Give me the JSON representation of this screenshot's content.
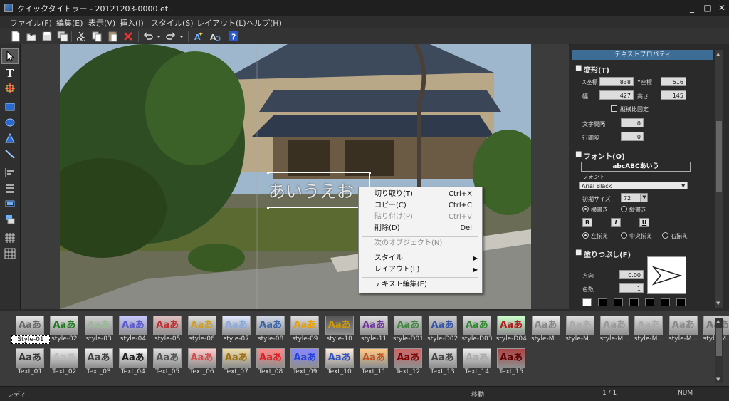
{
  "window": {
    "title": "クイックタイトラー - 20121203-0000.etl",
    "minimize": "_",
    "maximize": "□",
    "close": "✕"
  },
  "menu": [
    "ファイル(F)",
    "編集(E)",
    "表示(V)",
    "挿入(I)",
    "スタイル(S)",
    "レイアウト(L)",
    "ヘルプ(H)"
  ],
  "toolbar": [
    "new-icon",
    "open-icon",
    "save-icon",
    "save-as-icon",
    "cut-icon",
    "copy-icon",
    "paste-icon",
    "delete-icon",
    "undo-icon",
    "redo-icon",
    "text-effect-icon",
    "text-effect2-icon",
    "help-icon"
  ],
  "tools": [
    "select-tool-icon",
    "text-tool-icon",
    "crosshair-tool-icon",
    "rectangle-tool-icon",
    "ellipse-tool-icon",
    "triangle-tool-icon",
    "line-tool-icon",
    "align-tool-icon",
    "distribute-tool-icon",
    "group-tool-icon",
    "layer-tool-icon",
    "grid-tool-icon",
    "grid2-tool-icon"
  ],
  "canvas": {
    "text_object": "あいうえお"
  },
  "context_menu": {
    "items": [
      {
        "label": "切り取り(T)",
        "shortcut": "Ctrl+X",
        "enabled": true
      },
      {
        "label": "コピー(C)",
        "shortcut": "Ctrl+C",
        "enabled": true
      },
      {
        "label": "貼り付け(P)",
        "shortcut": "Ctrl+V",
        "enabled": false
      },
      {
        "label": "削除(D)",
        "shortcut": "Del",
        "enabled": true
      },
      {
        "label": "次のオブジェクト(N)",
        "shortcut": "",
        "enabled": false
      },
      {
        "label": "スタイル",
        "shortcut": "",
        "enabled": true,
        "submenu": true
      },
      {
        "label": "レイアウト(L)",
        "shortcut": "",
        "enabled": true,
        "submenu": true
      },
      {
        "label": "テキスト編集(E)",
        "shortcut": "",
        "enabled": true
      }
    ]
  },
  "props": {
    "title": "テキストプロパティ",
    "transform": {
      "header": "変形(T)",
      "x_label": "X座標",
      "x": "838",
      "y_label": "Y座標",
      "y": "516",
      "w_label": "幅",
      "w": "427",
      "h_label": "高さ",
      "h": "145",
      "ratio_label": "縦横比固定",
      "char_space_label": "文字間隔",
      "char_space": "0",
      "line_space_label": "行間隔",
      "line_space": "0"
    },
    "font": {
      "header": "フォント(O)",
      "preview": "abcABCあいう",
      "font_label": "フォント",
      "font_value": "Arial Black",
      "size_label": "初期サイズ",
      "size": "72",
      "horizontal": "横書き",
      "vertical": "縦書き",
      "bold": "B",
      "italic": "I",
      "underline": "U",
      "align_left": "左揃え",
      "align_center": "中央揃え",
      "align_right": "右揃え"
    },
    "fill": {
      "header": "塗りつぶし(F)",
      "direction_label": "方向",
      "direction": "0.00",
      "colors_label": "色数",
      "colors": "1"
    }
  },
  "styles": [
    {
      "label": "Style-01",
      "color": "#666",
      "bg": "#e6e6e6"
    },
    {
      "label": "style-02",
      "color": "#1e7b1e",
      "bg": "#e6e6e6"
    },
    {
      "label": "style-03",
      "color": "#9ab89a",
      "bg": "#d0d0d0"
    },
    {
      "label": "style-04",
      "color": "#5a5acf",
      "bg": "#c8c8ff"
    },
    {
      "label": "style-05",
      "color": "#c03030",
      "bg": "#e0c0c0"
    },
    {
      "label": "style-06",
      "color": "#d0a020",
      "bg": "#ddd"
    },
    {
      "label": "style-07",
      "color": "#88aadd",
      "bg": "#e0e8ff"
    },
    {
      "label": "style-08",
      "color": "#3a63a8",
      "bg": "#d0d8e8"
    },
    {
      "label": "style-09",
      "color": "#e8a000",
      "bg": "#ddd"
    },
    {
      "label": "style-10",
      "color": "#d09a00",
      "bg": "#555"
    },
    {
      "label": "style-11",
      "color": "#7030a0",
      "bg": "#ddd"
    },
    {
      "label": "style-D01",
      "color": "#3a8a3a",
      "bg": "#ccc"
    },
    {
      "label": "style-D02",
      "color": "#3355aa",
      "bg": "#ccc"
    },
    {
      "label": "style-D03",
      "color": "#2a8a2a",
      "bg": "#ddd"
    },
    {
      "label": "style-D04",
      "color": "#b02020",
      "bg": "#cfc"
    },
    {
      "label": "style-M...",
      "color": "#888",
      "bg": "#eee"
    },
    {
      "label": "style-M...",
      "color": "#aaa",
      "bg": "#ddd"
    },
    {
      "label": "style-M...",
      "color": "#999",
      "bg": "#ddd"
    },
    {
      "label": "style-M...",
      "color": "#aaa",
      "bg": "#ddd"
    },
    {
      "label": "style-M...",
      "color": "#888",
      "bg": "#ddd"
    },
    {
      "label": "style-M...",
      "color": "#777",
      "bg": "#ccc"
    },
    {
      "label": "Text_01",
      "color": "#333",
      "bg": "#ddd"
    },
    {
      "label": "Text_02",
      "color": "#bbb",
      "bg": "#eee"
    },
    {
      "label": "Text_03",
      "color": "#444",
      "bg": "#eee"
    },
    {
      "label": "Text_04",
      "color": "#222",
      "bg": "#fff"
    },
    {
      "label": "Text_05",
      "color": "#555",
      "bg": "#ddd"
    },
    {
      "label": "Text_06",
      "color": "#d05050",
      "bg": "#fcc"
    },
    {
      "label": "Text_07",
      "color": "#a07010",
      "bg": "#eda"
    },
    {
      "label": "Text_08",
      "color": "#e02020",
      "bg": "#f88"
    },
    {
      "label": "Text_09",
      "color": "#2040e0",
      "bg": "#88f"
    },
    {
      "label": "Text_10",
      "color": "#3050c0",
      "bg": "#fed"
    },
    {
      "label": "Text_11",
      "color": "#c05020",
      "bg": "#fc8"
    },
    {
      "label": "Text_12",
      "color": "#800000",
      "bg": "#c66"
    },
    {
      "label": "Text_13",
      "color": "#444",
      "bg": "#ddd"
    },
    {
      "label": "Text_14",
      "color": "#aaa",
      "bg": "#eee"
    },
    {
      "label": "Text_15",
      "color": "#600",
      "bg": "#a44"
    }
  ],
  "status": {
    "ready": "レディ",
    "mode": "移動",
    "page": "1 / 1",
    "num": "NUM"
  }
}
